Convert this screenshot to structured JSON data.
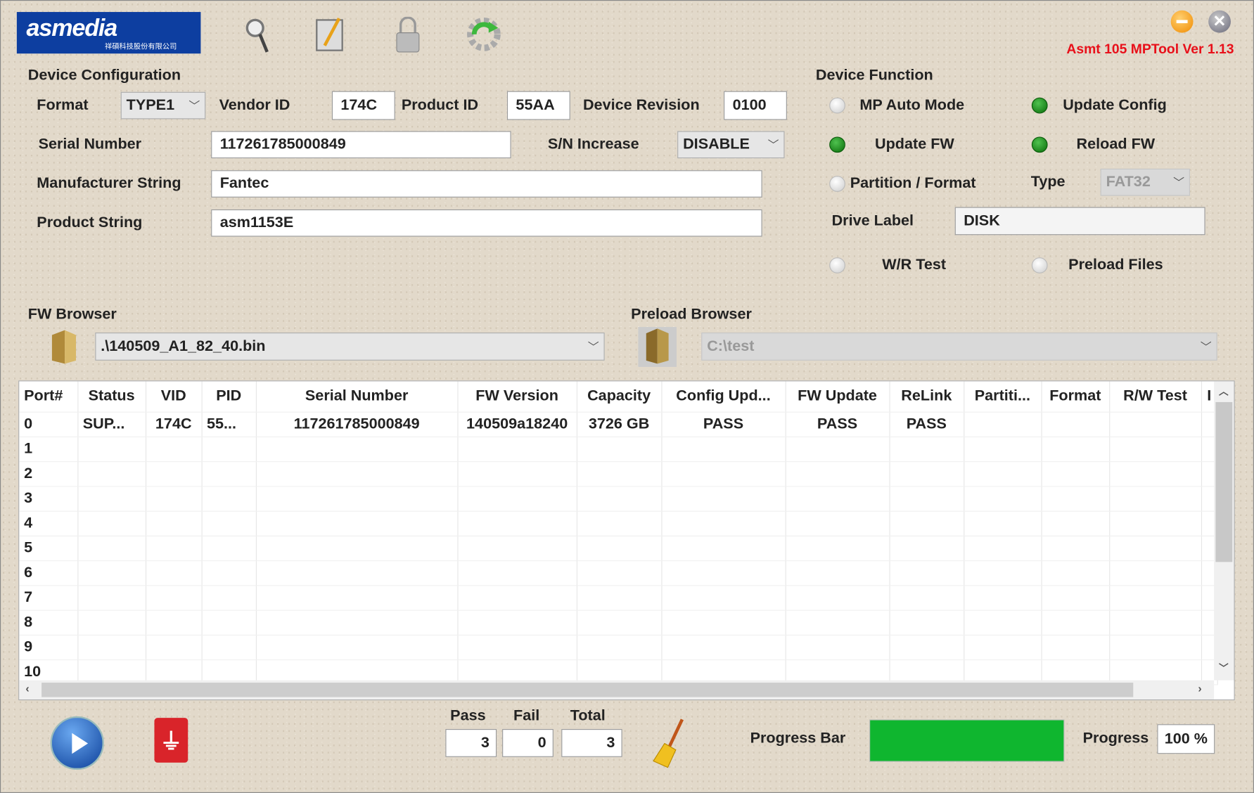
{
  "header": {
    "logo_text": "asmedia",
    "logo_subtext": "祥碩科技股份有限公司",
    "version": "Asmt 105 MPTool Ver 1.13",
    "icons": [
      "search-icon",
      "notepad-edit-icon",
      "lock-icon",
      "gear-refresh-icon"
    ]
  },
  "config": {
    "title": "Device Configuration",
    "format_label": "Format",
    "format_value": "TYPE1",
    "vendor_label": "Vendor ID",
    "vendor_value": "174C",
    "product_label": "Product ID",
    "product_value": "55AA",
    "revision_label": "Device Revision",
    "revision_value": "0100",
    "serial_label": "Serial Number",
    "serial_value": "117261785000849",
    "sn_increase_label": "S/N Increase",
    "sn_increase_value": "DISABLE",
    "manufacturer_label": "Manufacturer String",
    "manufacturer_value": "Fantec",
    "product_string_label": "Product String",
    "product_string_value": "asm1153E"
  },
  "function": {
    "title": "Device Function",
    "mp_auto": {
      "label": "MP Auto Mode",
      "on": false
    },
    "update_config": {
      "label": "Update Config",
      "on": true
    },
    "update_fw": {
      "label": "Update FW",
      "on": true
    },
    "reload_fw": {
      "label": "Reload FW",
      "on": true
    },
    "partition": {
      "label": "Partition / Format",
      "on": false
    },
    "type_label": "Type",
    "type_value": "FAT32",
    "drive_label": "Drive Label",
    "drive_value": "DISK",
    "wr_test": {
      "label": "W/R Test",
      "on": false
    },
    "preload": {
      "label": "Preload Files",
      "on": false
    }
  },
  "browser": {
    "fw_title": "FW Browser",
    "fw_value": ".\\140509_A1_82_40.bin",
    "preload_title": "Preload Browser",
    "preload_value": "C:\\test"
  },
  "table": {
    "columns": [
      "Port#",
      "Status",
      "VID",
      "PID",
      "Serial Number",
      "FW Version",
      "Capacity",
      "Config Upd...",
      "FW Update",
      "ReLink",
      "Partiti...",
      "Format",
      "R/W Test",
      "I"
    ],
    "rows": [
      [
        "0",
        "SUP...",
        "174C",
        "55...",
        "117261785000849",
        "140509a18240",
        "3726 GB",
        "PASS",
        "PASS",
        "PASS",
        "",
        "",
        "",
        ""
      ],
      [
        "1"
      ],
      [
        "2"
      ],
      [
        "3"
      ],
      [
        "4"
      ],
      [
        "5"
      ],
      [
        "6"
      ],
      [
        "7"
      ],
      [
        "8"
      ],
      [
        "9"
      ],
      [
        "10"
      ]
    ]
  },
  "footer": {
    "pass_label": "Pass",
    "pass": "3",
    "fail_label": "Fail",
    "fail": "0",
    "total_label": "Total",
    "total": "3",
    "progress_bar_label": "Progress Bar",
    "progress_label": "Progress",
    "progress_text": "100 %",
    "progress": 100,
    "bar_color": "#0fb62f"
  }
}
